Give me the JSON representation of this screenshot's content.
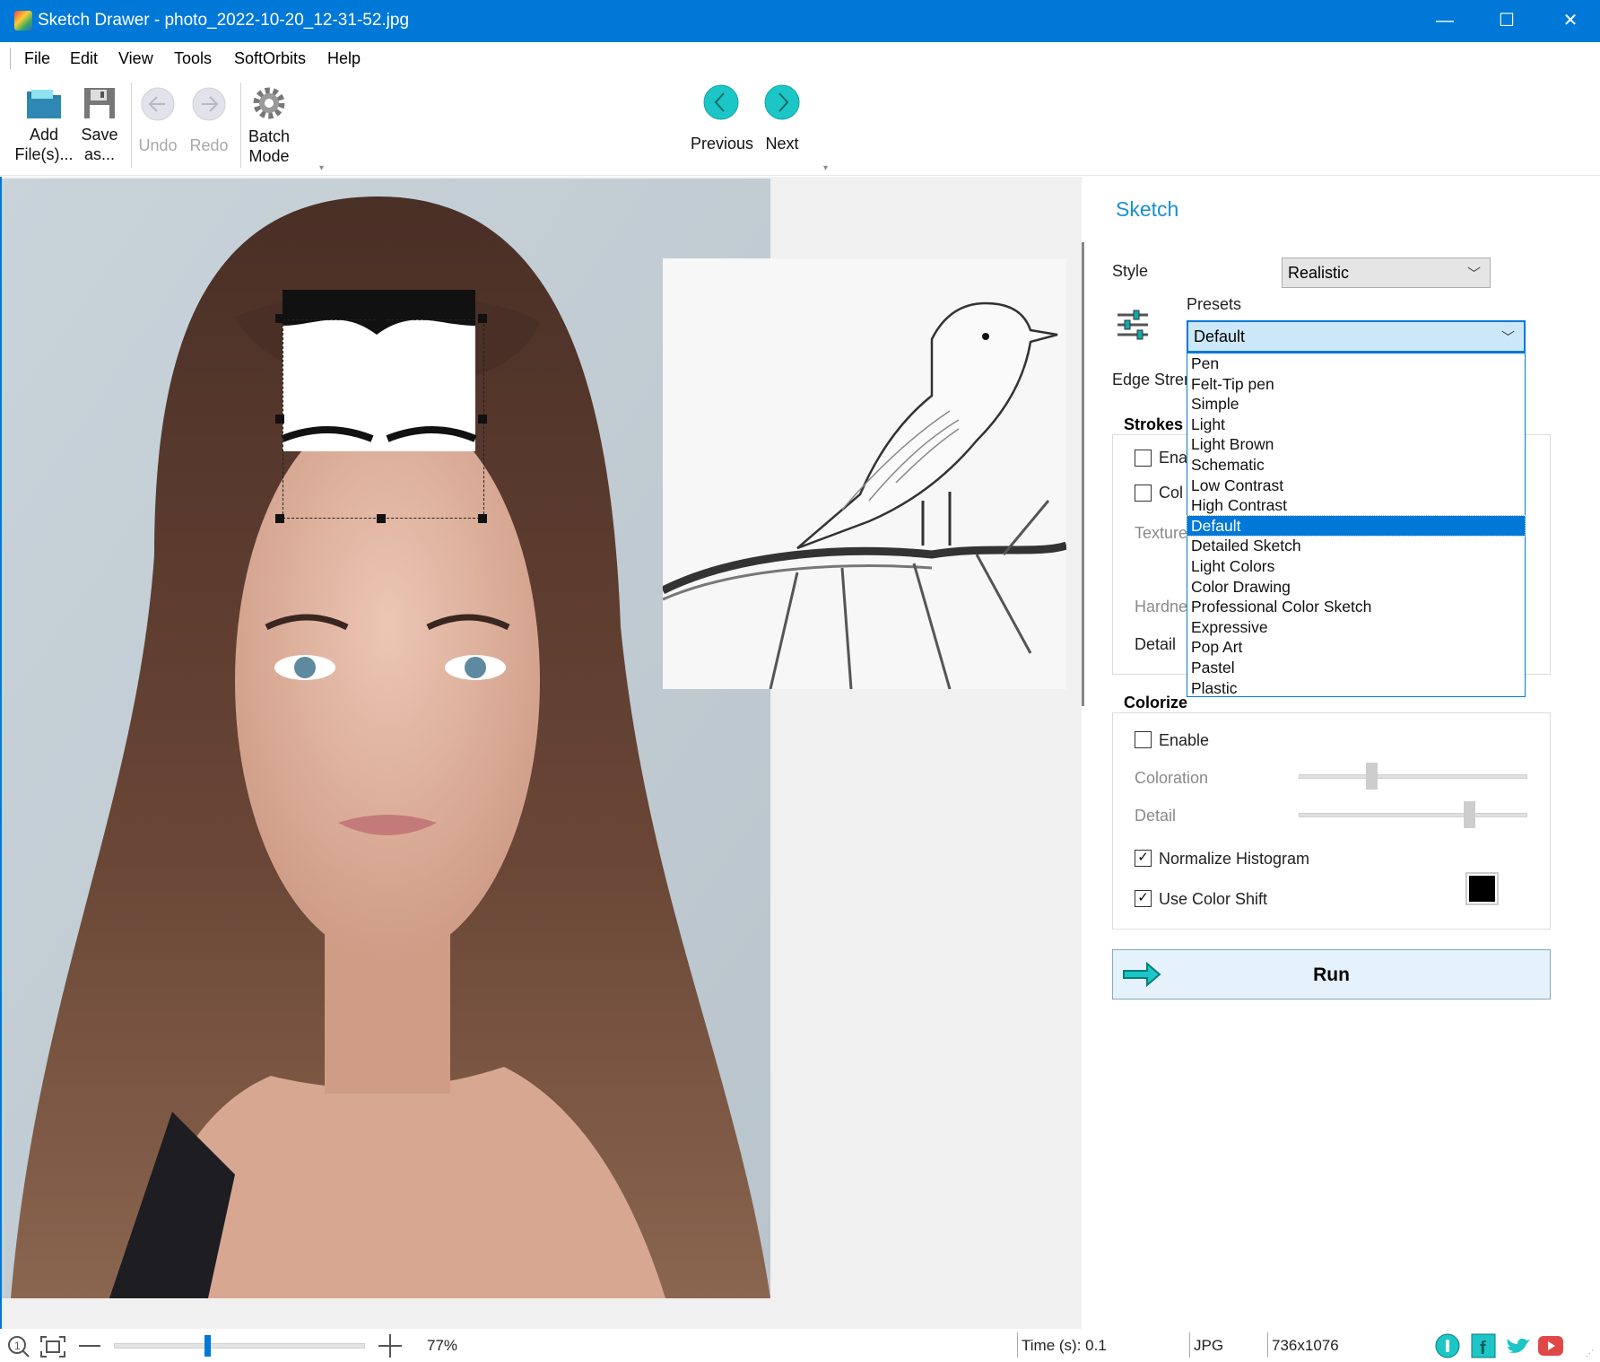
{
  "window": {
    "title": "Sketch Drawer - photo_2022-10-20_12-31-52.jpg",
    "minimize": "—",
    "maximize": "☐",
    "close": "✕"
  },
  "menu": [
    "File",
    "Edit",
    "View",
    "Tools",
    "SoftOrbits",
    "Help"
  ],
  "toolbar": {
    "add": [
      "Add",
      "File(s)..."
    ],
    "save": [
      "Save",
      "as..."
    ],
    "undo": "Undo",
    "redo": "Redo",
    "batch": [
      "Batch",
      "Mode"
    ],
    "previous": "Previous",
    "next": "Next"
  },
  "panel": {
    "title": "Sketch",
    "style_label": "Style",
    "style_value": "Realistic",
    "presets_label": "Presets",
    "presets_value": "Default",
    "edge_label": "Edge Stren",
    "strokes": {
      "title": "Strokes",
      "enable": "Ena",
      "color": "Col",
      "texture": "Texture",
      "hardness": "Hardne",
      "detail": "Detail"
    },
    "colorize": {
      "title": "Colorize",
      "enable": "Enable",
      "enable_checked": false,
      "coloration": "Coloration",
      "coloration_value": 0.31,
      "detail": "Detail",
      "detail_value": 0.76,
      "normalize": "Normalize Histogram",
      "normalize_checked": true,
      "color_shift": "Use Color Shift",
      "color_shift_checked": true,
      "shift_color": "#000000"
    },
    "run": "Run"
  },
  "presets_options": [
    "Pen",
    "Felt-Tip pen",
    "Simple",
    "Light",
    "Light Brown",
    "Schematic",
    "Low Contrast",
    "High Contrast",
    "Default",
    "Detailed Sketch",
    "Light Colors",
    "Color Drawing",
    "Professional Color Sketch",
    "Expressive",
    "Pop Art",
    "Pastel",
    "Plastic"
  ],
  "presets_selected_index": 8,
  "status": {
    "zoom": "77%",
    "zoom_value": 0.37,
    "time": "Time (s): 0.1",
    "format": "JPG",
    "dimensions": "736x1076"
  },
  "colors": {
    "accent": "#0078d7",
    "nav_teal": "#1cc6c6",
    "panel_title": "#1a8fd0"
  }
}
